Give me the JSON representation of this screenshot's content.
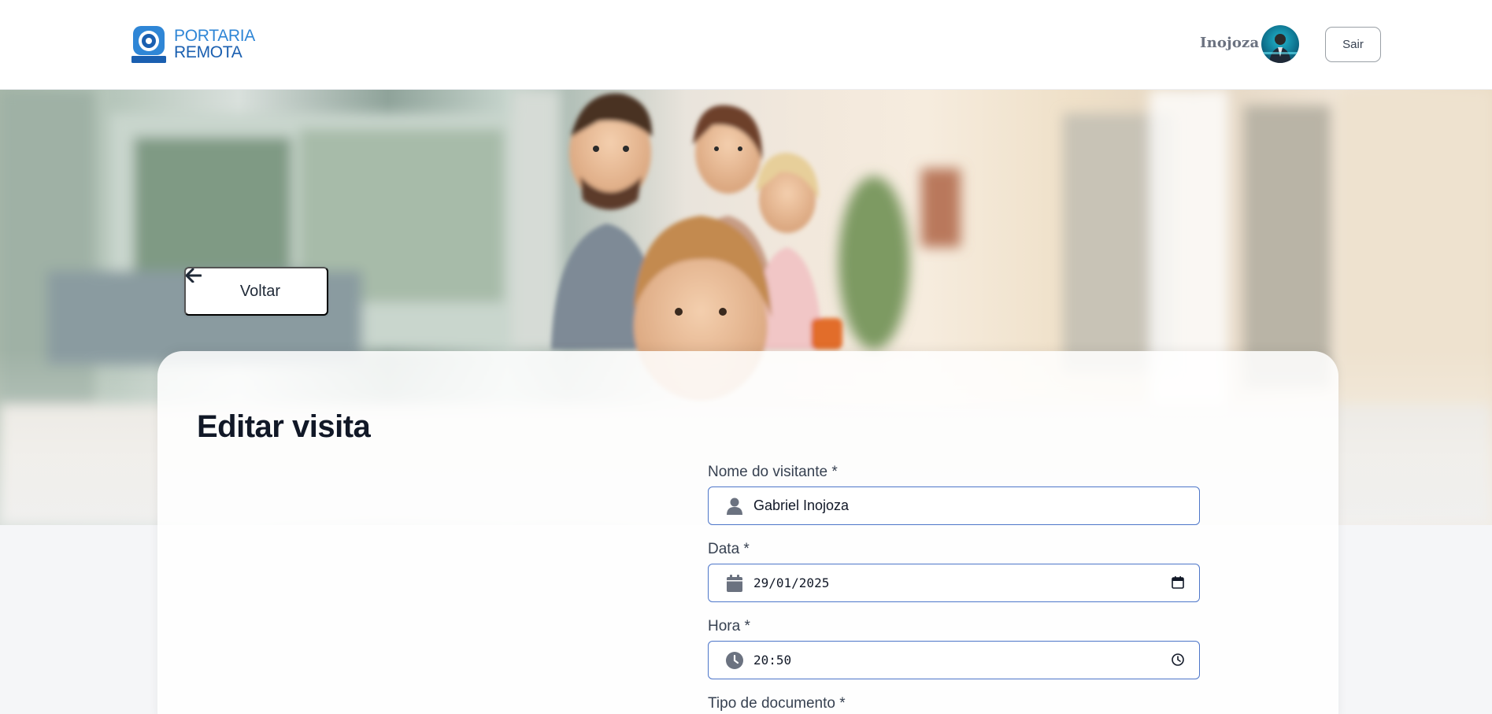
{
  "header": {
    "brand_line1": "PORTARIA",
    "brand_line2": "REMOTA",
    "user_name": "Inojoza",
    "logout_label": "Sair"
  },
  "hero": {
    "back_label": "Voltar"
  },
  "form": {
    "title": "Editar visita",
    "fields": [
      {
        "label": "Nome do visitante *",
        "value": "Gabriel Inojoza",
        "icon": "user-icon"
      },
      {
        "label": "Data *",
        "value": "29/01/2025",
        "icon": "calendar-icon",
        "trailing_icon": "calendar-picker-icon"
      },
      {
        "label": "Hora *",
        "value": "20:50",
        "icon": "clock-icon",
        "trailing_icon": "clock-picker-icon"
      },
      {
        "label": "Tipo de documento *"
      }
    ]
  },
  "colors": {
    "accent_border": "#4d76c9",
    "brand_light": "#2f86d6",
    "brand_dark": "#1a5fb0"
  }
}
